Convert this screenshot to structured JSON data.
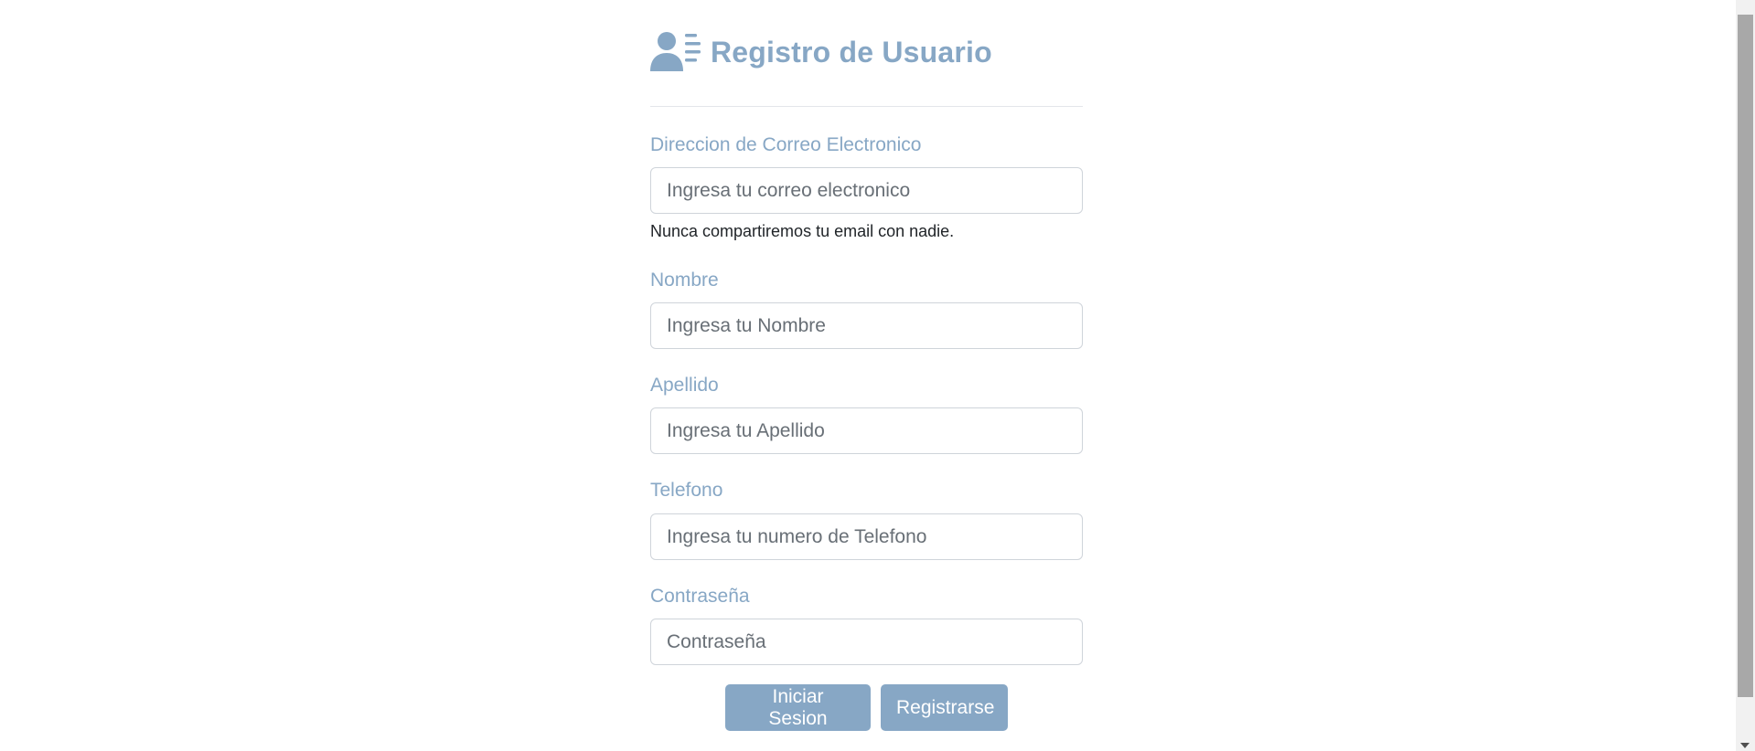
{
  "form": {
    "title": "Registro de Usuario",
    "icon": "user-list-icon",
    "accent_color": "#87a7c5",
    "email": {
      "label": "Direccion de Correo Electronico",
      "placeholder": "Ingresa tu correo electronico",
      "value": "",
      "help": "Nunca compartiremos tu email con nadie."
    },
    "first_name": {
      "label": "Nombre",
      "placeholder": "Ingresa tu Nombre",
      "value": ""
    },
    "last_name": {
      "label": "Apellido",
      "placeholder": "Ingresa tu Apellido",
      "value": ""
    },
    "phone": {
      "label": "Telefono",
      "placeholder": "Ingresa tu numero de Telefono",
      "value": ""
    },
    "password": {
      "label": "Contraseña",
      "placeholder": "Contraseña",
      "value": ""
    },
    "buttons": {
      "login_label": "Iniciar Sesion",
      "register_label": "Registrarse"
    }
  }
}
